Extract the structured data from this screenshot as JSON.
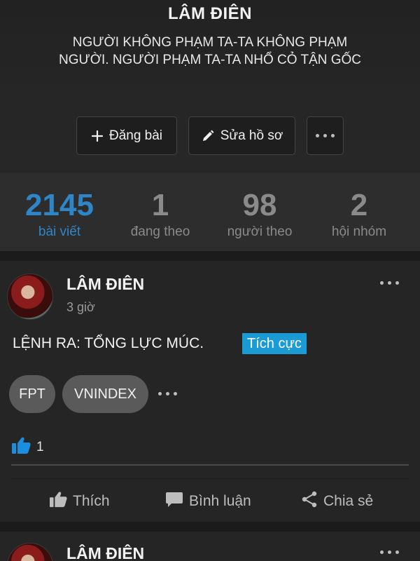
{
  "profile": {
    "name": "LÂM ĐIÊN",
    "bio": "NGƯỜI KHÔNG PHẠM TA-TA KHÔNG PHẠM NGƯỜI. NGƯỜI PHẠM TA-TA NHỔ CỎ TẬN GỐC",
    "actions": {
      "post_label": "Đăng bài",
      "edit_label": "Sửa hồ sơ"
    }
  },
  "stats": [
    {
      "value": "2145",
      "label": "bài viết",
      "active": true
    },
    {
      "value": "1",
      "label": "đang theo",
      "active": false
    },
    {
      "value": "98",
      "label": "người theo",
      "active": false
    },
    {
      "value": "2",
      "label": "hội nhóm",
      "active": false
    }
  ],
  "posts": [
    {
      "author": "LÂM ĐIÊN",
      "time": "3 giờ",
      "text": "LỆNH RA: TỔNG LỰC MÚC.",
      "sentiment": "Tích cực",
      "tags": [
        "FPT",
        "VNINDEX"
      ],
      "like_count": "1",
      "actions": {
        "like": "Thích",
        "comment": "Bình luận",
        "share": "Chia sẻ"
      }
    },
    {
      "author": "LÂM ĐIÊN"
    }
  ],
  "colors": {
    "accent": "#2e86c9",
    "badge": "#1a9bd6",
    "like_icon": "#1a8fe0"
  },
  "icons": [
    "plus-icon",
    "pencil-icon",
    "more-dots-icon",
    "thumbs-up-icon",
    "comment-icon",
    "share-icon"
  ]
}
